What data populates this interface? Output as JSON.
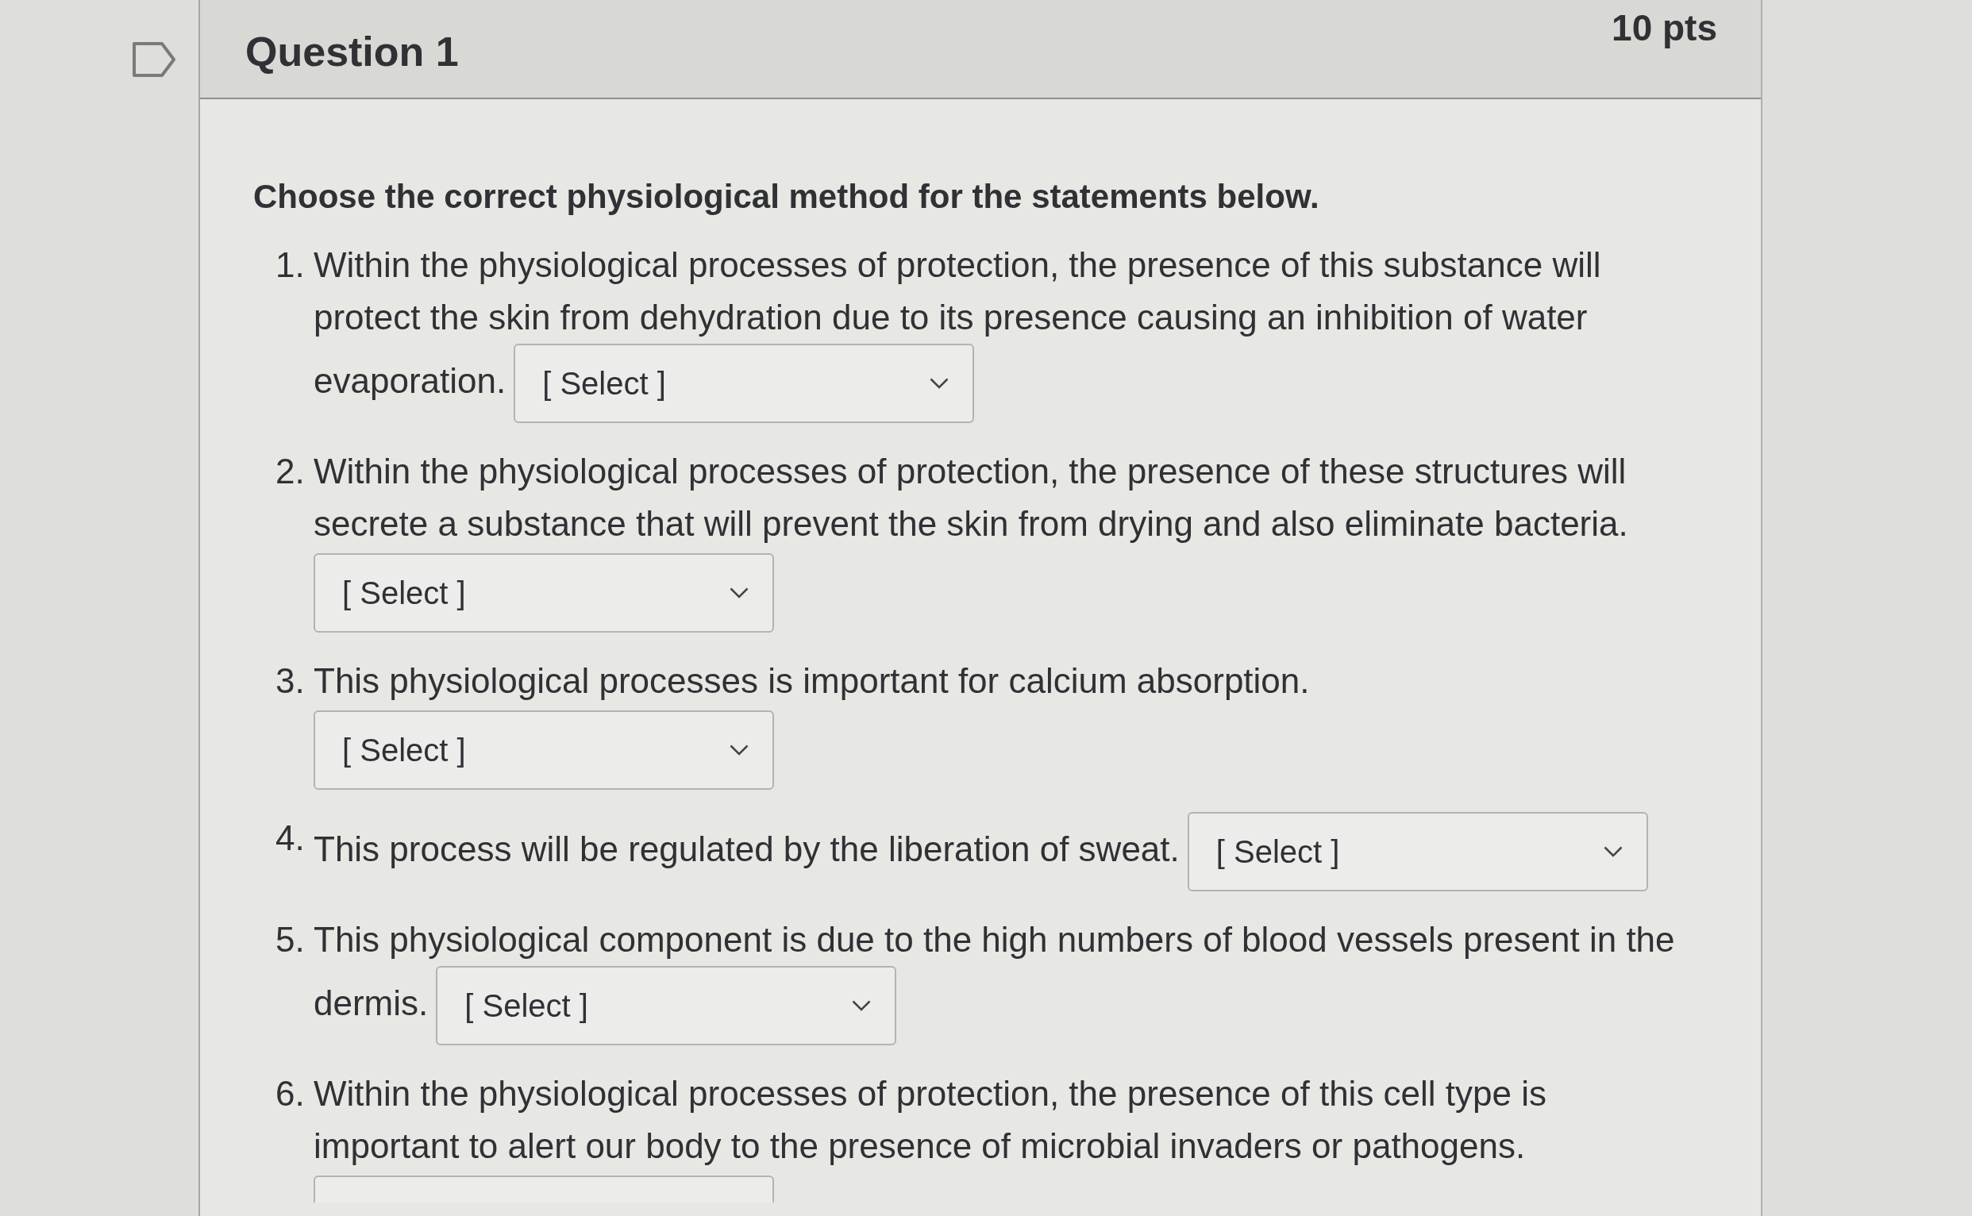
{
  "question": {
    "title": "Question 1",
    "points": "10 pts"
  },
  "prompt": "Choose the correct physiological method for the statements below.",
  "items": [
    {
      "number": "1.",
      "text": "Within the physiological processes of protection, the presence of this substance will protect the skin from dehydration due to its presence causing an inhibition of water evaporation.",
      "kind": "inline",
      "answer_box": {
        "placeholder": "[ Select ]"
      }
    },
    {
      "number": "2.",
      "text": "Within the physiological processes of protection, the presence of these structures will secrete a substance that will prevent the skin from drying and also eliminate bacteria.",
      "kind": "below",
      "answer_box": {
        "placeholder": "[ Select ]"
      }
    },
    {
      "number": "3.",
      "text": "This physiological processes is important for calcium absorption.",
      "kind": "below",
      "answer_box": {
        "placeholder": "[ Select ]"
      }
    },
    {
      "number": "4.",
      "text": "This process will be regulated by the liberation of sweat.",
      "kind": "inline",
      "answer_box": {
        "placeholder": "[ Select ]"
      }
    },
    {
      "number": "5.",
      "text": "This physiological component is due to the high numbers of blood vessels present in the dermis.",
      "kind": "inline",
      "answer_box": {
        "placeholder": "[ Select ]"
      }
    },
    {
      "number": "6.",
      "text": "Within the physiological processes of protection, the presence of this cell type is important to alert our body to the presence of microbial invaders or pathogens.",
      "kind": "below",
      "answer_box": {
        "clipped": true
      }
    }
  ]
}
